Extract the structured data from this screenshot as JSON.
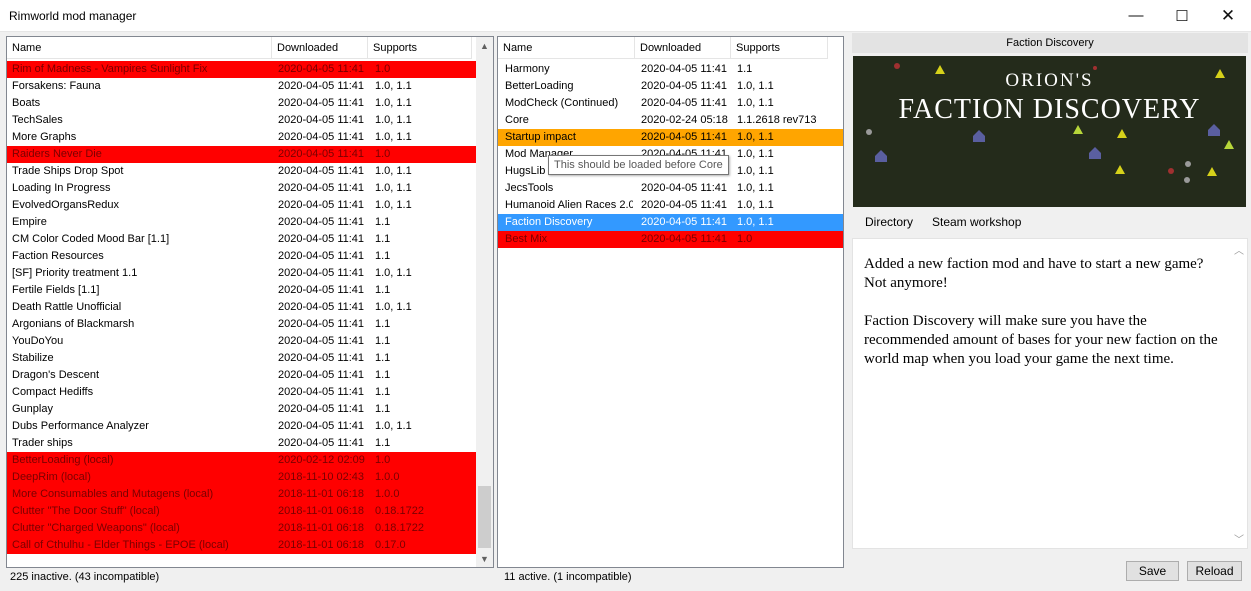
{
  "window": {
    "title": "Rimworld mod manager",
    "min_glyph": "—",
    "max_glyph": "☐",
    "close_glyph": "✕"
  },
  "columns": {
    "name": "Name",
    "downloaded": "Downloaded",
    "supports": "Supports"
  },
  "inactive": {
    "rows": [
      {
        "name": "Rim of Madness - Vampires Sunlight Fix",
        "downloaded": "2020-04-05 11:41",
        "supports": "1.0",
        "state": "red"
      },
      {
        "name": "Forsakens: Fauna",
        "downloaded": "2020-04-05 11:41",
        "supports": "1.0, 1.1",
        "state": ""
      },
      {
        "name": "Boats",
        "downloaded": "2020-04-05 11:41",
        "supports": "1.0, 1.1",
        "state": ""
      },
      {
        "name": "TechSales",
        "downloaded": "2020-04-05 11:41",
        "supports": "1.0, 1.1",
        "state": ""
      },
      {
        "name": "More Graphs",
        "downloaded": "2020-04-05 11:41",
        "supports": "1.0, 1.1",
        "state": ""
      },
      {
        "name": "Raiders Never Die",
        "downloaded": "2020-04-05 11:41",
        "supports": "1.0",
        "state": "red"
      },
      {
        "name": "Trade Ships Drop Spot",
        "downloaded": "2020-04-05 11:41",
        "supports": "1.0, 1.1",
        "state": ""
      },
      {
        "name": "Loading In Progress",
        "downloaded": "2020-04-05 11:41",
        "supports": "1.0, 1.1",
        "state": ""
      },
      {
        "name": "EvolvedOrgansRedux",
        "downloaded": "2020-04-05 11:41",
        "supports": "1.0, 1.1",
        "state": ""
      },
      {
        "name": "Empire",
        "downloaded": "2020-04-05 11:41",
        "supports": "1.1",
        "state": ""
      },
      {
        "name": "CM Color Coded Mood Bar [1.1]",
        "downloaded": "2020-04-05 11:41",
        "supports": "1.1",
        "state": ""
      },
      {
        "name": "Faction Resources",
        "downloaded": "2020-04-05 11:41",
        "supports": "1.1",
        "state": ""
      },
      {
        "name": "[SF] Priority treatment 1.1",
        "downloaded": "2020-04-05 11:41",
        "supports": "1.0, 1.1",
        "state": ""
      },
      {
        "name": "Fertile Fields [1.1]",
        "downloaded": "2020-04-05 11:41",
        "supports": "1.1",
        "state": ""
      },
      {
        "name": "Death Rattle Unofficial",
        "downloaded": "2020-04-05 11:41",
        "supports": "1.0, 1.1",
        "state": ""
      },
      {
        "name": "Argonians of Blackmarsh",
        "downloaded": "2020-04-05 11:41",
        "supports": "1.1",
        "state": ""
      },
      {
        "name": "YouDoYou",
        "downloaded": "2020-04-05 11:41",
        "supports": "1.1",
        "state": ""
      },
      {
        "name": "Stabilize",
        "downloaded": "2020-04-05 11:41",
        "supports": "1.1",
        "state": ""
      },
      {
        "name": "Dragon's Descent",
        "downloaded": "2020-04-05 11:41",
        "supports": "1.1",
        "state": ""
      },
      {
        "name": "Compact Hediffs",
        "downloaded": "2020-04-05 11:41",
        "supports": "1.1",
        "state": ""
      },
      {
        "name": "Gunplay",
        "downloaded": "2020-04-05 11:41",
        "supports": "1.1",
        "state": ""
      },
      {
        "name": "Dubs Performance Analyzer",
        "downloaded": "2020-04-05 11:41",
        "supports": "1.0, 1.1",
        "state": ""
      },
      {
        "name": "Trader ships",
        "downloaded": "2020-04-05 11:41",
        "supports": "1.1",
        "state": ""
      },
      {
        "name": "BetterLoading (local)",
        "downloaded": "2020-02-12 02:09",
        "supports": "1.0",
        "state": "red"
      },
      {
        "name": "DeepRim (local)",
        "downloaded": "2018-11-10 02:43",
        "supports": "1.0.0",
        "state": "red"
      },
      {
        "name": "More Consumables and Mutagens (local)",
        "downloaded": "2018-11-01 06:18",
        "supports": "1.0.0",
        "state": "red"
      },
      {
        "name": "Clutter \"The Door Stuff\" (local)",
        "downloaded": "2018-11-01 06:18",
        "supports": "0.18.1722",
        "state": "red"
      },
      {
        "name": "Clutter \"Charged Weapons\" (local)",
        "downloaded": "2018-11-01 06:18",
        "supports": "0.18.1722",
        "state": "red"
      },
      {
        "name": "Call of Cthulhu - Elder Things - EPOE (local)",
        "downloaded": "2018-11-01 06:18",
        "supports": "0.17.0",
        "state": "red"
      }
    ],
    "status": "225 inactive. (43 incompatible)"
  },
  "active": {
    "rows": [
      {
        "name": "Harmony",
        "downloaded": "2020-04-05 11:41",
        "supports": "1.1",
        "state": ""
      },
      {
        "name": "BetterLoading",
        "downloaded": "2020-04-05 11:41",
        "supports": "1.0, 1.1",
        "state": ""
      },
      {
        "name": "ModCheck (Continued)",
        "downloaded": "2020-04-05 11:41",
        "supports": "1.0, 1.1",
        "state": ""
      },
      {
        "name": "Core",
        "downloaded": "2020-02-24 05:18",
        "supports": "1.1.2618 rev713",
        "state": ""
      },
      {
        "name": "Startup impact",
        "downloaded": "2020-04-05 11:41",
        "supports": "1.0, 1.1",
        "state": "orange"
      },
      {
        "name": "Mod Manager",
        "downloaded": "2020-04-05 11:41",
        "supports": "1.0, 1.1",
        "state": ""
      },
      {
        "name": "HugsLib",
        "downloaded": "2020-04-05 11:41",
        "supports": "1.0, 1.1",
        "state": ""
      },
      {
        "name": "JecsTools",
        "downloaded": "2020-04-05 11:41",
        "supports": "1.0, 1.1",
        "state": ""
      },
      {
        "name": "Humanoid Alien Races 2.0",
        "downloaded": "2020-04-05 11:41",
        "supports": "1.0, 1.1",
        "state": ""
      },
      {
        "name": "Faction Discovery",
        "downloaded": "2020-04-05 11:41",
        "supports": "1.0, 1.1",
        "state": "selected"
      },
      {
        "name": "Best Mix",
        "downloaded": "2020-04-05 11:41",
        "supports": "1.0",
        "state": "red"
      }
    ],
    "status": "11 active. (1 incompatible)",
    "tooltip": "This should be loaded before Core"
  },
  "detail": {
    "title": "Faction Discovery",
    "preview_line1": "ORION'S",
    "preview_line2": "FACTION DISCOVERY",
    "tab_directory": "Directory",
    "tab_workshop": "Steam workshop",
    "description": "Added a new faction mod and have to start a new game? Not anymore!\n\nFaction Discovery will make sure you have the recommended amount of bases for your new faction on the world map when you load your game the next time."
  },
  "buttons": {
    "save": "Save",
    "reload": "Reload"
  },
  "colors": {
    "incompatible": "#ff0000",
    "warning": "#ffa500",
    "selected": "#3399ff"
  }
}
